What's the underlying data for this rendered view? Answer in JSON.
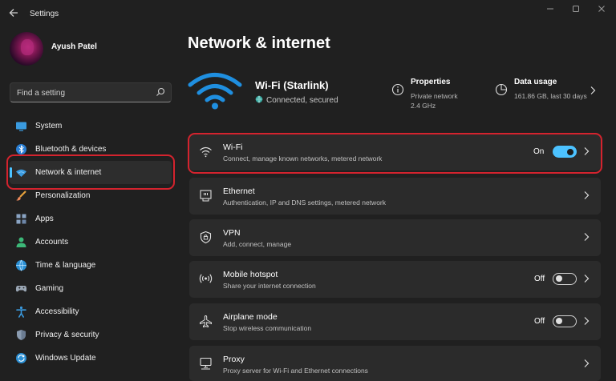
{
  "app": {
    "title": "Settings"
  },
  "window": {
    "back_icon": "back-arrow-icon",
    "minimize_icon": "minimize-icon",
    "maximize_icon": "maximize-icon",
    "close_icon": "close-icon"
  },
  "profile": {
    "name": "Ayush Patel"
  },
  "search": {
    "placeholder": "Find a setting",
    "icon": "search-icon"
  },
  "sidebar": {
    "items": [
      {
        "label": "System",
        "icon": "system-icon",
        "active": false
      },
      {
        "label": "Bluetooth & devices",
        "icon": "bluetooth-icon",
        "active": false
      },
      {
        "label": "Network & internet",
        "icon": "network-icon",
        "active": true
      },
      {
        "label": "Personalization",
        "icon": "personalization-brush-icon",
        "active": false
      },
      {
        "label": "Apps",
        "icon": "apps-icon",
        "active": false
      },
      {
        "label": "Accounts",
        "icon": "accounts-icon",
        "active": false
      },
      {
        "label": "Time & language",
        "icon": "time-language-icon",
        "active": false
      },
      {
        "label": "Gaming",
        "icon": "gaming-icon",
        "active": false
      },
      {
        "label": "Accessibility",
        "icon": "accessibility-icon",
        "active": false
      },
      {
        "label": "Privacy & security",
        "icon": "shield-icon",
        "active": false
      },
      {
        "label": "Windows Update",
        "icon": "windows-update-icon",
        "active": false
      }
    ]
  },
  "main": {
    "title": "Network & internet",
    "hero": {
      "network_name": "Wi-Fi (Starlink)",
      "status": "Connected, secured",
      "properties": {
        "title": "Properties",
        "line1": "Private network",
        "line2": "2.4 GHz"
      },
      "data_usage": {
        "title": "Data usage",
        "line1": "161.86 GB, last 30 days"
      }
    },
    "cards": [
      {
        "title": "Wi-Fi",
        "subtitle": "Connect, manage known networks, metered network",
        "icon": "wifi-icon",
        "toggle": "On"
      },
      {
        "title": "Ethernet",
        "subtitle": "Authentication, IP and DNS settings, metered network",
        "icon": "ethernet-icon"
      },
      {
        "title": "VPN",
        "subtitle": "Add, connect, manage",
        "icon": "vpn-shield-icon"
      },
      {
        "title": "Mobile hotspot",
        "subtitle": "Share your internet connection",
        "icon": "hotspot-icon",
        "toggle": "Off"
      },
      {
        "title": "Airplane mode",
        "subtitle": "Stop wireless communication",
        "icon": "airplane-icon",
        "toggle": "Off"
      },
      {
        "title": "Proxy",
        "subtitle": "Proxy server for Wi-Fi and Ethernet connections",
        "icon": "proxy-icon"
      }
    ]
  },
  "colors": {
    "accent": "#4cc2ff",
    "highlight_box": "#d4232e",
    "background": "#202020",
    "card": "#2b2b2b"
  }
}
